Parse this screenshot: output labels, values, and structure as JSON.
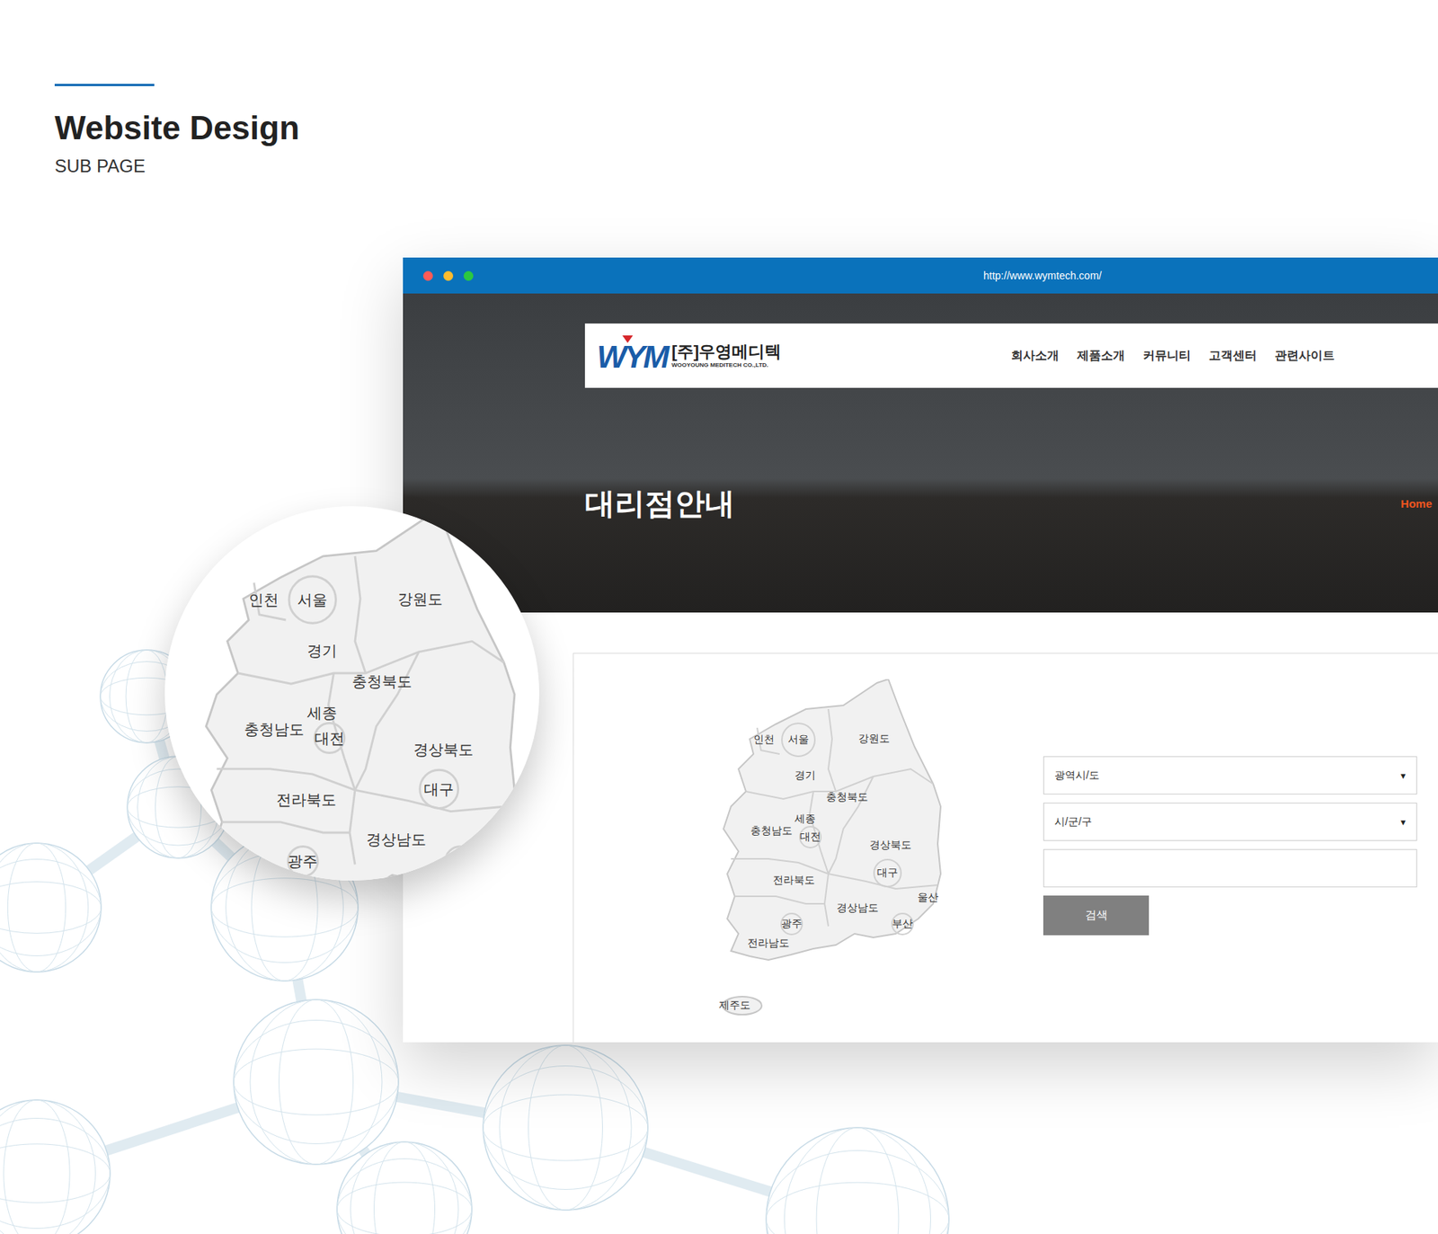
{
  "header": {
    "title": "Website Design",
    "subtitle": "SUB PAGE"
  },
  "browser": {
    "url": "http://www.wymtech.com/"
  },
  "site": {
    "logo": {
      "mark": "WYM",
      "name": "[주]우영메디텍",
      "subtitle": "WOOYOUNG MEDITECH CO.,LTD."
    },
    "nav": [
      "회사소개",
      "제품소개",
      "커뮤니티",
      "고객센터",
      "관련사이트"
    ],
    "page_title": "대리점안내",
    "breadcrumb": "Home"
  },
  "map": {
    "regions": [
      "인천",
      "서울",
      "강원도",
      "경기",
      "충청북도",
      "세종",
      "충청남도",
      "대전",
      "경상북도",
      "대구",
      "전라북도",
      "울산",
      "경상남도",
      "부산",
      "광주",
      "전라남도",
      "제주도"
    ]
  },
  "lens": {
    "labels": [
      "인천",
      "서울",
      "강원도",
      "경기",
      "충청북도",
      "세종",
      "충청남도",
      "대전",
      "경상북도",
      "대구",
      "전라북도",
      "경상남도",
      "광주"
    ]
  },
  "search": {
    "fields": [
      {
        "kind": "select",
        "placeholder": "광역시/도",
        "arrow": "▼"
      },
      {
        "kind": "select",
        "placeholder": "시/군/구",
        "arrow": "▼"
      },
      {
        "kind": "text",
        "placeholder": ""
      }
    ],
    "button": "검색"
  }
}
